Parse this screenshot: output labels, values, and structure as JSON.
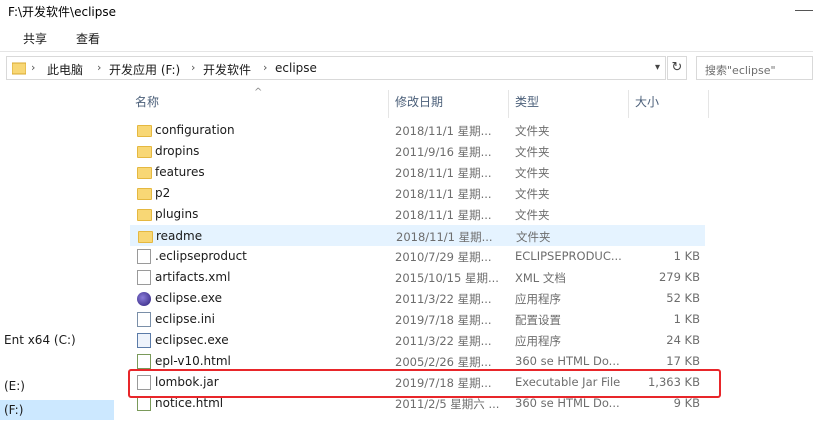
{
  "window": {
    "title": "F:\\开发软件\\eclipse"
  },
  "ribbon": {
    "tabs": [
      "共享",
      "查看"
    ]
  },
  "address": {
    "crumbs": [
      "此电脑",
      "开发应用 (F:)",
      "开发软件",
      "eclipse"
    ],
    "search_placeholder": "搜索\"eclipse\""
  },
  "nav": {
    "items": [
      {
        "label": "Ent x64 (C:)",
        "selected": false
      },
      {
        "label": "(E:)",
        "selected": false
      },
      {
        "label": "(F:)",
        "selected": true
      }
    ]
  },
  "columns": {
    "name": "名称",
    "date": "修改日期",
    "type": "类型",
    "size": "大小"
  },
  "files": [
    {
      "name": "configuration",
      "date": "2018/11/1 星期...",
      "type": "文件夹",
      "size": "",
      "icon": "folder-icon"
    },
    {
      "name": "dropins",
      "date": "2011/9/16 星期...",
      "type": "文件夹",
      "size": "",
      "icon": "folder-icon"
    },
    {
      "name": "features",
      "date": "2018/11/1 星期...",
      "type": "文件夹",
      "size": "",
      "icon": "folder-icon"
    },
    {
      "name": "p2",
      "date": "2018/11/1 星期...",
      "type": "文件夹",
      "size": "",
      "icon": "folder-icon"
    },
    {
      "name": "plugins",
      "date": "2018/11/1 星期...",
      "type": "文件夹",
      "size": "",
      "icon": "folder-icon"
    },
    {
      "name": "readme",
      "date": "2018/11/1 星期...",
      "type": "文件夹",
      "size": "",
      "icon": "folder-icon",
      "hover": true
    },
    {
      "name": ".eclipseproduct",
      "date": "2010/7/29 星期...",
      "type": "ECLIPSEPRODUC...",
      "size": "1 KB",
      "icon": "file-icon"
    },
    {
      "name": "artifacts.xml",
      "date": "2015/10/15 星期...",
      "type": "XML 文档",
      "size": "279 KB",
      "icon": "xml-file-icon"
    },
    {
      "name": "eclipse.exe",
      "date": "2011/3/22 星期...",
      "type": "应用程序",
      "size": "52 KB",
      "icon": "eclipse-app-icon"
    },
    {
      "name": "eclipse.ini",
      "date": "2019/7/18 星期...",
      "type": "配置设置",
      "size": "1 KB",
      "icon": "ini-file-icon"
    },
    {
      "name": "eclipsec.exe",
      "date": "2011/3/22 星期...",
      "type": "应用程序",
      "size": "24 KB",
      "icon": "console-app-icon"
    },
    {
      "name": "epl-v10.html",
      "date": "2005/2/26 星期...",
      "type": "360 se HTML Do...",
      "size": "17 KB",
      "icon": "html-file-icon"
    },
    {
      "name": "lombok.jar",
      "date": "2019/7/18 星期...",
      "type": "Executable Jar File",
      "size": "1,363 KB",
      "icon": "jar-file-icon"
    },
    {
      "name": "notice.html",
      "date": "2011/2/5 星期六 ...",
      "type": "360 se HTML Do...",
      "size": "9 KB",
      "icon": "html-file-icon"
    }
  ],
  "colors": {
    "highlight": "#e8262a",
    "selection": "#cce8ff",
    "hover": "#e5f3ff"
  }
}
